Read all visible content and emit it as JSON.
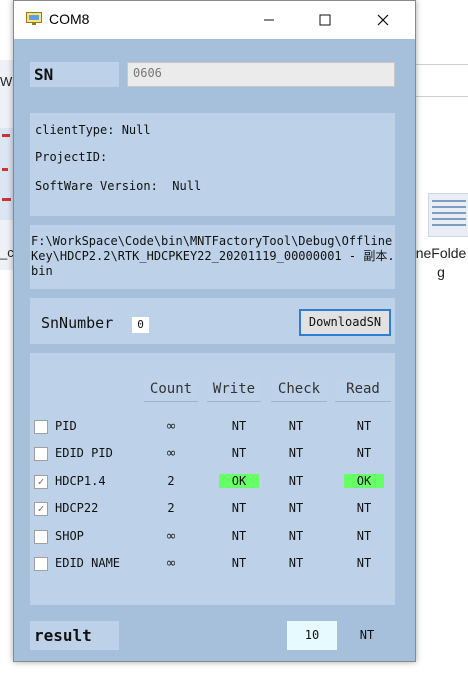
{
  "background": {
    "left_text_top": "Wi",
    "left_text_bottom": "_c",
    "right_label_line1": "neFolde",
    "right_label_line2": "g"
  },
  "window": {
    "title": "COM8",
    "controls": {
      "minimize": "—",
      "maximize": "☐",
      "close": "✕"
    }
  },
  "sn": {
    "label": "SN",
    "value": "0606"
  },
  "info": {
    "client_type": "clientType: Null",
    "project_id": "ProjectID:",
    "software_version": "SoftWare Version:  Null"
  },
  "key_path": "F:\\WorkSpace\\Code\\bin\\MNTFactoryTool\\Debug\\OfflineKey\\HDCP2.2\\RTK_HDCPKEY22_20201119_00000001 - 副本.bin",
  "sn_number": {
    "label": "SnNumber",
    "value": "0",
    "download_label": "DownloadSN"
  },
  "table": {
    "headers": [
      "Count",
      "Write",
      "Check",
      "Read"
    ],
    "rows": [
      {
        "label": "PID",
        "checked": false,
        "count": "∞",
        "write": "NT",
        "check": "NT",
        "read": "NT"
      },
      {
        "label": "EDID PID",
        "checked": false,
        "count": "∞",
        "write": "NT",
        "check": "NT",
        "read": "NT"
      },
      {
        "label": "HDCP1.4",
        "checked": true,
        "count": "2",
        "write": "OK",
        "check": "NT",
        "read": "OK"
      },
      {
        "label": "HDCP22",
        "checked": true,
        "count": "2",
        "write": "NT",
        "check": "NT",
        "read": "NT"
      },
      {
        "label": "SHOP",
        "checked": false,
        "count": "∞",
        "write": "NT",
        "check": "NT",
        "read": "NT"
      },
      {
        "label": "EDID NAME",
        "checked": false,
        "count": "∞",
        "write": "NT",
        "check": "NT",
        "read": "NT"
      }
    ]
  },
  "result": {
    "label": "result",
    "count": "10",
    "status": "NT"
  },
  "colors": {
    "window_bg": "#a6c0dc",
    "panel_bg": "#bdd2e8",
    "ok_bg": "#66ff66",
    "accent_border": "#2d7fd6"
  }
}
